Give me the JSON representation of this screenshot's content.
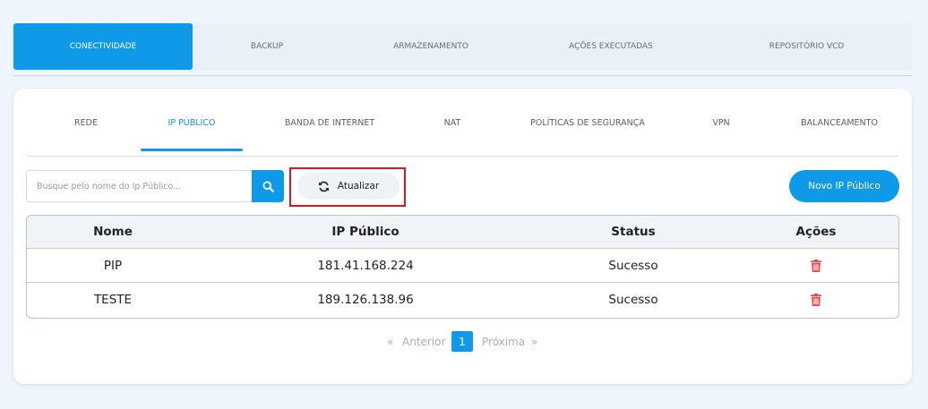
{
  "top_tabs": [
    {
      "label": "CONECTIVIDADE",
      "active": true
    },
    {
      "label": "BACKUP"
    },
    {
      "label": "ARMAZENAMENTO"
    },
    {
      "label": "AÇÕES EXECUTADAS"
    },
    {
      "label": "REPOSITÓRIO VCD"
    }
  ],
  "sub_tabs": [
    {
      "label": "REDE"
    },
    {
      "label": "IP PÚBLICO",
      "active": true
    },
    {
      "label": "BANDA DE INTERNET"
    },
    {
      "label": "NAT"
    },
    {
      "label": "POLÍTICAS DE SEGURANÇA"
    },
    {
      "label": "VPN"
    },
    {
      "label": "BALANCEAMENTO"
    }
  ],
  "toolbar": {
    "search_placeholder": "Busque pelo nome do Ip Público...",
    "search_value": "",
    "refresh_label": "Atualizar",
    "new_label": "Novo IP Público"
  },
  "table": {
    "headers": [
      "Nome",
      "IP Público",
      "Status",
      "Ações"
    ],
    "rows": [
      {
        "nome": "PIP",
        "ip": "181.41.168.224",
        "status": "Sucesso"
      },
      {
        "nome": "TESTE",
        "ip": "189.126.138.96",
        "status": "Sucesso"
      }
    ]
  },
  "pagination": {
    "first": "«",
    "prev": "Anterior",
    "current": "1",
    "next": "Próxima",
    "last": "»"
  },
  "colors": {
    "accent": "#0e9ae8",
    "danger": "#e5484d",
    "highlight": "#e1141a"
  },
  "icons": {
    "search": "search-icon",
    "refresh": "refresh-icon",
    "delete": "trash-icon"
  }
}
